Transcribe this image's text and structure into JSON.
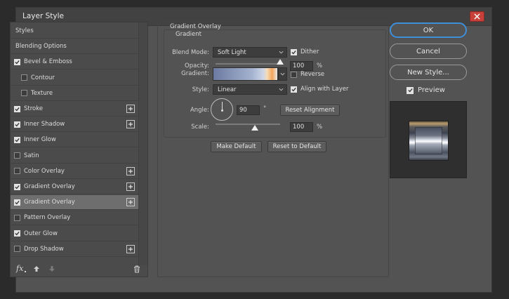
{
  "window": {
    "title": "Layer Style"
  },
  "left_panel": {
    "items": [
      {
        "label": "Styles",
        "type": "plain"
      },
      {
        "label": "Blending Options",
        "type": "plain"
      },
      {
        "label": "Bevel & Emboss",
        "checked": true,
        "plus": false
      },
      {
        "label": "Contour",
        "checked": false,
        "plus": false,
        "indent": true
      },
      {
        "label": "Texture",
        "checked": false,
        "plus": false,
        "indent": true
      },
      {
        "label": "Stroke",
        "checked": true,
        "plus": true
      },
      {
        "label": "Inner Shadow",
        "checked": true,
        "plus": true
      },
      {
        "label": "Inner Glow",
        "checked": true,
        "plus": false
      },
      {
        "label": "Satin",
        "checked": false,
        "plus": false
      },
      {
        "label": "Color Overlay",
        "checked": false,
        "plus": true
      },
      {
        "label": "Gradient Overlay",
        "checked": true,
        "plus": true
      },
      {
        "label": "Gradient Overlay",
        "checked": true,
        "plus": true,
        "selected": true
      },
      {
        "label": "Pattern Overlay",
        "checked": false,
        "plus": false
      },
      {
        "label": "Outer Glow",
        "checked": true,
        "plus": false
      },
      {
        "label": "Drop Shadow",
        "checked": false,
        "plus": true
      }
    ],
    "footer": {
      "fx_label": "fx"
    }
  },
  "settings": {
    "section_title": "Gradient Overlay",
    "group_title": "Gradient",
    "blend_mode": {
      "label": "Blend Mode:",
      "value": "Soft Light"
    },
    "dither": {
      "label": "Dither",
      "checked": true
    },
    "opacity": {
      "label": "Opacity:",
      "value": "100",
      "unit": "%",
      "level": 1.0
    },
    "gradient": {
      "label": "Gradient:"
    },
    "reverse": {
      "label": "Reverse",
      "checked": false
    },
    "style": {
      "label": "Style:",
      "value": "Linear"
    },
    "align_with_layer": {
      "label": "Align with Layer",
      "checked": true
    },
    "angle": {
      "label": "Angle:",
      "value": "90",
      "unit": "°"
    },
    "reset_alignment": "Reset Alignment",
    "scale": {
      "label": "Scale:",
      "value": "100",
      "unit": "%"
    },
    "make_default": "Make Default",
    "reset_to_default": "Reset to Default"
  },
  "right_panel": {
    "ok": "OK",
    "cancel": "Cancel",
    "new_style": "New Style...",
    "preview": {
      "label": "Preview",
      "checked": true
    }
  },
  "colors": {
    "accent": "#3e8ed8",
    "close": "#c7403a"
  }
}
